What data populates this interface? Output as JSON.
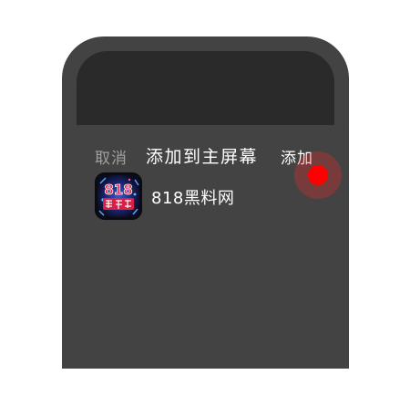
{
  "sheet": {
    "cancel_label": "取消",
    "title": "添加到主屏幕",
    "add_label": "添加"
  },
  "app": {
    "name": "818黑料网",
    "icon_label": "818黑料网",
    "icon": "app-logo-icon"
  },
  "colors": {
    "sheet_bg": "#434343",
    "backdrop": "#2a2a2a",
    "tap_indicator": "#ff0000"
  }
}
